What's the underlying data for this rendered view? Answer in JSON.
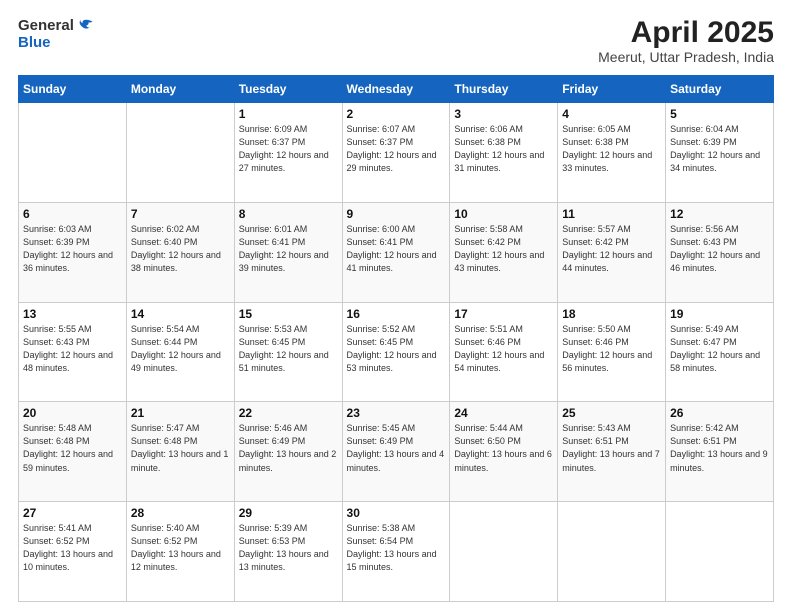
{
  "logo": {
    "general": "General",
    "blue": "Blue"
  },
  "title": {
    "month": "April 2025",
    "location": "Meerut, Uttar Pradesh, India"
  },
  "days_header": [
    "Sunday",
    "Monday",
    "Tuesday",
    "Wednesday",
    "Thursday",
    "Friday",
    "Saturday"
  ],
  "weeks": [
    [
      {
        "day": "",
        "info": ""
      },
      {
        "day": "",
        "info": ""
      },
      {
        "day": "1",
        "info": "Sunrise: 6:09 AM\nSunset: 6:37 PM\nDaylight: 12 hours and 27 minutes."
      },
      {
        "day": "2",
        "info": "Sunrise: 6:07 AM\nSunset: 6:37 PM\nDaylight: 12 hours and 29 minutes."
      },
      {
        "day": "3",
        "info": "Sunrise: 6:06 AM\nSunset: 6:38 PM\nDaylight: 12 hours and 31 minutes."
      },
      {
        "day": "4",
        "info": "Sunrise: 6:05 AM\nSunset: 6:38 PM\nDaylight: 12 hours and 33 minutes."
      },
      {
        "day": "5",
        "info": "Sunrise: 6:04 AM\nSunset: 6:39 PM\nDaylight: 12 hours and 34 minutes."
      }
    ],
    [
      {
        "day": "6",
        "info": "Sunrise: 6:03 AM\nSunset: 6:39 PM\nDaylight: 12 hours and 36 minutes."
      },
      {
        "day": "7",
        "info": "Sunrise: 6:02 AM\nSunset: 6:40 PM\nDaylight: 12 hours and 38 minutes."
      },
      {
        "day": "8",
        "info": "Sunrise: 6:01 AM\nSunset: 6:41 PM\nDaylight: 12 hours and 39 minutes."
      },
      {
        "day": "9",
        "info": "Sunrise: 6:00 AM\nSunset: 6:41 PM\nDaylight: 12 hours and 41 minutes."
      },
      {
        "day": "10",
        "info": "Sunrise: 5:58 AM\nSunset: 6:42 PM\nDaylight: 12 hours and 43 minutes."
      },
      {
        "day": "11",
        "info": "Sunrise: 5:57 AM\nSunset: 6:42 PM\nDaylight: 12 hours and 44 minutes."
      },
      {
        "day": "12",
        "info": "Sunrise: 5:56 AM\nSunset: 6:43 PM\nDaylight: 12 hours and 46 minutes."
      }
    ],
    [
      {
        "day": "13",
        "info": "Sunrise: 5:55 AM\nSunset: 6:43 PM\nDaylight: 12 hours and 48 minutes."
      },
      {
        "day": "14",
        "info": "Sunrise: 5:54 AM\nSunset: 6:44 PM\nDaylight: 12 hours and 49 minutes."
      },
      {
        "day": "15",
        "info": "Sunrise: 5:53 AM\nSunset: 6:45 PM\nDaylight: 12 hours and 51 minutes."
      },
      {
        "day": "16",
        "info": "Sunrise: 5:52 AM\nSunset: 6:45 PM\nDaylight: 12 hours and 53 minutes."
      },
      {
        "day": "17",
        "info": "Sunrise: 5:51 AM\nSunset: 6:46 PM\nDaylight: 12 hours and 54 minutes."
      },
      {
        "day": "18",
        "info": "Sunrise: 5:50 AM\nSunset: 6:46 PM\nDaylight: 12 hours and 56 minutes."
      },
      {
        "day": "19",
        "info": "Sunrise: 5:49 AM\nSunset: 6:47 PM\nDaylight: 12 hours and 58 minutes."
      }
    ],
    [
      {
        "day": "20",
        "info": "Sunrise: 5:48 AM\nSunset: 6:48 PM\nDaylight: 12 hours and 59 minutes."
      },
      {
        "day": "21",
        "info": "Sunrise: 5:47 AM\nSunset: 6:48 PM\nDaylight: 13 hours and 1 minute."
      },
      {
        "day": "22",
        "info": "Sunrise: 5:46 AM\nSunset: 6:49 PM\nDaylight: 13 hours and 2 minutes."
      },
      {
        "day": "23",
        "info": "Sunrise: 5:45 AM\nSunset: 6:49 PM\nDaylight: 13 hours and 4 minutes."
      },
      {
        "day": "24",
        "info": "Sunrise: 5:44 AM\nSunset: 6:50 PM\nDaylight: 13 hours and 6 minutes."
      },
      {
        "day": "25",
        "info": "Sunrise: 5:43 AM\nSunset: 6:51 PM\nDaylight: 13 hours and 7 minutes."
      },
      {
        "day": "26",
        "info": "Sunrise: 5:42 AM\nSunset: 6:51 PM\nDaylight: 13 hours and 9 minutes."
      }
    ],
    [
      {
        "day": "27",
        "info": "Sunrise: 5:41 AM\nSunset: 6:52 PM\nDaylight: 13 hours and 10 minutes."
      },
      {
        "day": "28",
        "info": "Sunrise: 5:40 AM\nSunset: 6:52 PM\nDaylight: 13 hours and 12 minutes."
      },
      {
        "day": "29",
        "info": "Sunrise: 5:39 AM\nSunset: 6:53 PM\nDaylight: 13 hours and 13 minutes."
      },
      {
        "day": "30",
        "info": "Sunrise: 5:38 AM\nSunset: 6:54 PM\nDaylight: 13 hours and 15 minutes."
      },
      {
        "day": "",
        "info": ""
      },
      {
        "day": "",
        "info": ""
      },
      {
        "day": "",
        "info": ""
      }
    ]
  ]
}
